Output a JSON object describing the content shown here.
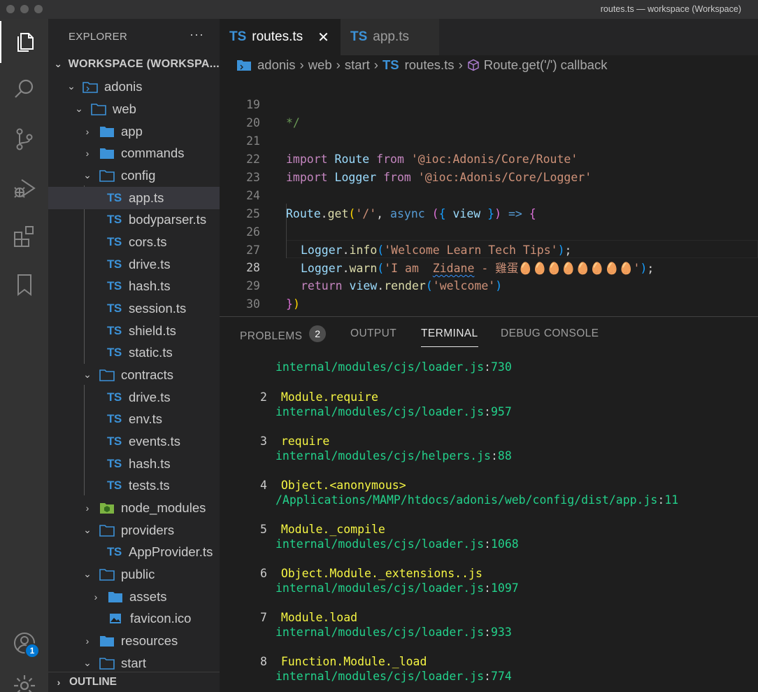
{
  "window": {
    "title": "routes.ts — workspace (Workspace)"
  },
  "activity_bar": {
    "items": [
      "explorer-icon",
      "search-icon",
      "source-control-icon",
      "run-debug-icon",
      "extensions-icon",
      "bookmarks-icon"
    ],
    "accounts_badge": "1"
  },
  "sidebar": {
    "title": "EXPLORER",
    "more": "···",
    "workspace": "WORKSPACE (WORKSPA...",
    "tree": [
      {
        "label": "adonis"
      },
      {
        "label": "web"
      },
      {
        "label": "app"
      },
      {
        "label": "commands"
      },
      {
        "label": "config"
      },
      {
        "label": "app.ts",
        "icon": "TS"
      },
      {
        "label": "bodyparser.ts",
        "icon": "TS"
      },
      {
        "label": "cors.ts",
        "icon": "TS"
      },
      {
        "label": "drive.ts",
        "icon": "TS"
      },
      {
        "label": "hash.ts",
        "icon": "TS"
      },
      {
        "label": "session.ts",
        "icon": "TS"
      },
      {
        "label": "shield.ts",
        "icon": "TS"
      },
      {
        "label": "static.ts",
        "icon": "TS"
      },
      {
        "label": "contracts"
      },
      {
        "label": "drive.ts",
        "icon": "TS"
      },
      {
        "label": "env.ts",
        "icon": "TS"
      },
      {
        "label": "events.ts",
        "icon": "TS"
      },
      {
        "label": "hash.ts",
        "icon": "TS"
      },
      {
        "label": "tests.ts",
        "icon": "TS"
      },
      {
        "label": "node_modules"
      },
      {
        "label": "providers"
      },
      {
        "label": "AppProvider.ts",
        "icon": "TS"
      },
      {
        "label": "public"
      },
      {
        "label": "assets"
      },
      {
        "label": "favicon.ico"
      },
      {
        "label": "resources"
      },
      {
        "label": "start"
      }
    ],
    "outline": "OUTLINE"
  },
  "tabs": [
    {
      "icon": "TS",
      "label": "routes.ts",
      "active": true
    },
    {
      "icon": "TS",
      "label": "app.ts",
      "active": false
    }
  ],
  "breadcrumb": {
    "items": [
      "adonis",
      "web",
      "start",
      "routes.ts",
      "Route.get('/') callback"
    ],
    "ts_icon": "TS"
  },
  "editor": {
    "line_numbers": [
      "19",
      "20",
      "21",
      "22",
      "23",
      "24",
      "25",
      "26",
      "27",
      "28",
      "29",
      "30"
    ],
    "current_line": "28",
    "lines": {
      "l19": "*/",
      "l21_kw": "import",
      "l21_id": "Route",
      "l21_from": "from",
      "l21_str": "'@ioc:Adonis/Core/Route'",
      "l22_kw": "import",
      "l22_id": "Logger",
      "l22_from": "from",
      "l22_str": "'@ioc:Adonis/Core/Logger'",
      "l24_obj": "Route",
      "l24_fn": "get",
      "l24_str": "'/'",
      "l24_async": "async",
      "l24_param": "view",
      "l24_arrow": "=>",
      "l26_obj": "Logger",
      "l26_fn": "info",
      "l26_str": "'Welcome Learn Tech Tips'",
      "l27_obj": "Logger",
      "l27_fn": "warn",
      "l27_str_a": "'I am  ",
      "l27_squiggle": "Zidane",
      "l27_str_b": " - 雞蛋🥚🥚🥚🥚🥚🥚🥚🥚'",
      "l28_kw": "return",
      "l28_obj": "view",
      "l28_fn": "render",
      "l28_str": "'welcome'"
    }
  },
  "panel": {
    "tabs": [
      "PROBLEMS",
      "OUTPUT",
      "TERMINAL",
      "DEBUG CONSOLE"
    ],
    "problems_count": "2",
    "active_tab": "TERMINAL",
    "terminal": {
      "first_path": "internal/modules/cjs/loader.js",
      "first_line": "730",
      "frames": [
        {
          "idx": "2",
          "fn": "Module.require",
          "path": "internal/modules/cjs/loader.js",
          "line": "957"
        },
        {
          "idx": "3",
          "fn": "require",
          "path": "internal/modules/cjs/helpers.js",
          "line": "88"
        },
        {
          "idx": "4",
          "fn": "Object.<anonymous>",
          "path": "/Applications/MAMP/htdocs/adonis/web/config/dist/app.js",
          "line": "11"
        },
        {
          "idx": "5",
          "fn": "Module._compile",
          "path": "internal/modules/cjs/loader.js",
          "line": "1068"
        },
        {
          "idx": "6",
          "fn": "Object.Module._extensions..js",
          "path": "internal/modules/cjs/loader.js",
          "line": "1097"
        },
        {
          "idx": "7",
          "fn": "Module.load",
          "path": "internal/modules/cjs/loader.js",
          "line": "933"
        },
        {
          "idx": "8",
          "fn": "Function.Module._load",
          "path": "internal/modules/cjs/loader.js",
          "line": "774"
        }
      ]
    }
  }
}
